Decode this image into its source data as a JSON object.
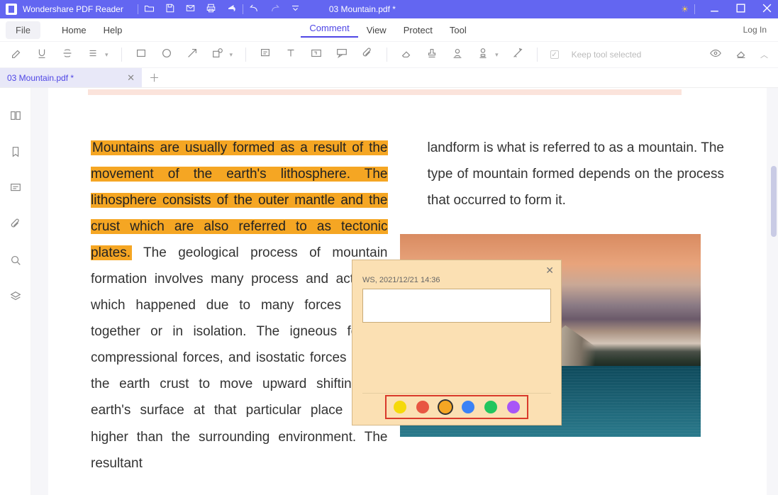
{
  "titlebar": {
    "app_name": "Wondershare PDF Reader",
    "filename": "03 Mountain.pdf *"
  },
  "menubar": {
    "file": "File",
    "home": "Home",
    "help": "Help",
    "comment": "Comment",
    "view": "View",
    "protect": "Protect",
    "tool": "Tool",
    "login": "Log In"
  },
  "toolbar": {
    "keep_tool": "Keep tool selected"
  },
  "tab": {
    "name": "03 Mountain.pdf *"
  },
  "document": {
    "left_highlight": "Mountains are usually formed as a result of the movement of the earth's lithosphere. The lithosphere consists of the outer mantle and the crust which are also referred to as tectonic plates.",
    "left_rest": " The geological process of mountain formation involves many process and activities which happened due to many forces acting together or in isolation. The igneous forces, compressional forces, and isostatic forces cause the earth crust to move upward shifting the earth's surface at that particular place to be higher than the surrounding environment. The resultant",
    "right": "landform is what is referred to as a mountain. The type of mountain formed depends on the process that occurred to form it."
  },
  "popup": {
    "author": "WS,",
    "timestamp": "2021/12/21 14:36",
    "note_value": "",
    "colors": {
      "yellow": "#f5d90a",
      "red": "#e85642",
      "orange": "#f5a623",
      "blue": "#3b82f6",
      "green": "#22c55e",
      "purple": "#a855f7"
    }
  }
}
